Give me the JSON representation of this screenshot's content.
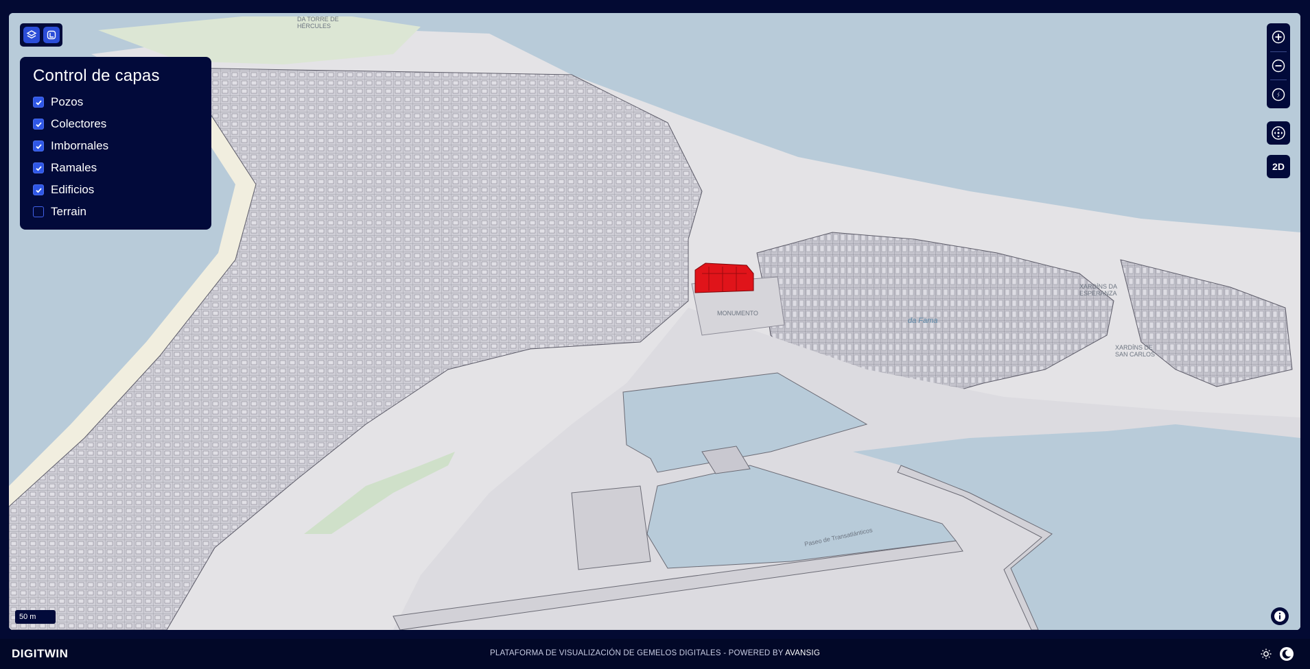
{
  "layer_panel": {
    "title": "Control de capas",
    "layers": [
      {
        "label": "Pozos",
        "checked": true
      },
      {
        "label": "Colectores",
        "checked": true
      },
      {
        "label": "Imbornales",
        "checked": true
      },
      {
        "label": "Ramales",
        "checked": true
      },
      {
        "label": "Edificios",
        "checked": true
      },
      {
        "label": "Terrain",
        "checked": false
      }
    ]
  },
  "top_left_buttons": {
    "layers_icon": "layers-icon",
    "legend_icon": "legend-icon"
  },
  "controls": {
    "zoom_in_icon": "plus-icon",
    "zoom_out_icon": "minus-icon",
    "compass_icon": "compass-icon",
    "navigation_icon": "navigation-icon",
    "view_mode_label": "2D"
  },
  "scale_bar": {
    "label": "50 m"
  },
  "map_labels": {
    "lighthouse": "DA TORRE DE\nHÉRCULES",
    "square": "MONUMENTO",
    "xardins_esperanza": "XARDÍNS DA\nESPERANZA",
    "praza_fama": "da Fama",
    "xardins_san_carlos": "XARDÍNS DE\nSAN CARLOS",
    "paseo_transatlanticos": "Paseo de Transatlánticos"
  },
  "footer": {
    "brand": "DIGITWIN",
    "text_prefix": "PLATAFORMA DE VISUALIZACIÓN DE GEMELOS DIGITALES - POWERED BY",
    "text_brand": "AVANSIG",
    "sun_icon": "sun-icon",
    "moon_icon": "moon-icon"
  },
  "colors": {
    "panel_bg": "#020a3a",
    "accent": "#2f57e6",
    "water": "#b8cbd9",
    "land": "#e4e3e6",
    "building": "#c9c8d0",
    "highlight_building": "#e0141a"
  }
}
